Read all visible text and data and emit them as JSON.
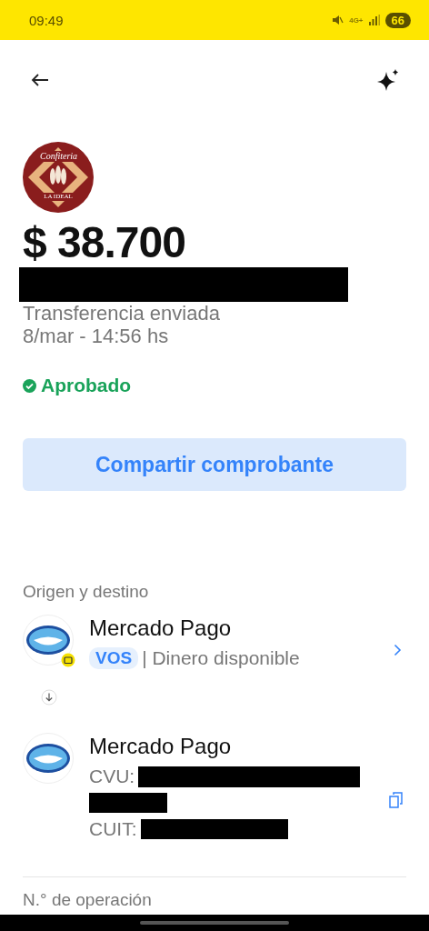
{
  "status_bar": {
    "time": "09:49",
    "network": "4G+",
    "battery": "66"
  },
  "merchant": {
    "logo_top": "Confiteria",
    "logo_bottom": "LA IDEAL"
  },
  "amount": "$ 38.700",
  "description": "Transferencia enviada",
  "datetime": "8/mar - 14:56 hs",
  "status": {
    "label": "Aprobado",
    "kind": "approved"
  },
  "share_button": "Compartir comprobante",
  "section_title": "Origen y destino",
  "origin": {
    "name": "Mercado Pago",
    "tag": "VOS",
    "detail": "| Dinero disponible"
  },
  "destination": {
    "name": "Mercado Pago",
    "cvu_label": "CVU:",
    "cuit_label": "CUIT:"
  },
  "next_section": "N.° de operación"
}
